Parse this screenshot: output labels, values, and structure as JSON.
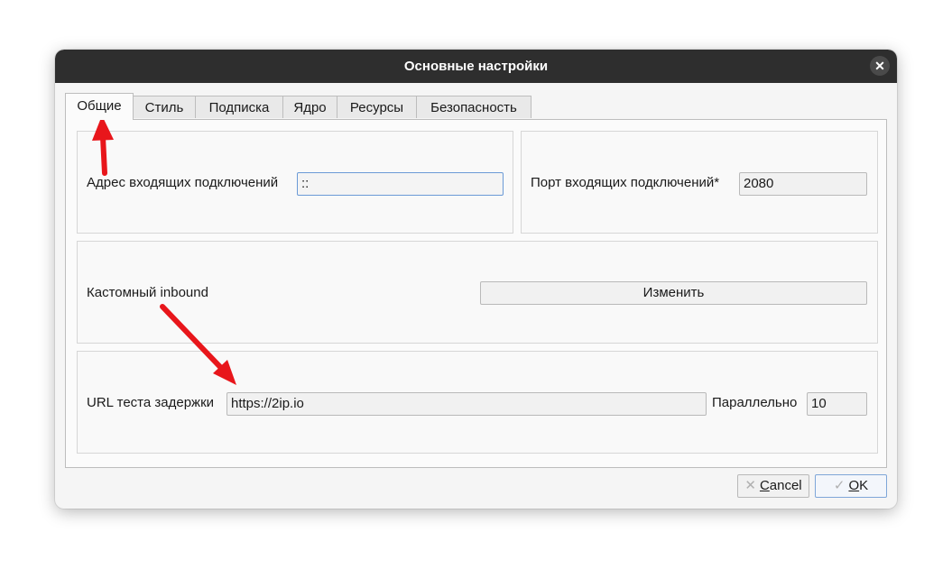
{
  "window": {
    "title": "Основные настройки",
    "close_icon": "close-icon"
  },
  "tabs": [
    {
      "label": "Общие",
      "active": true
    },
    {
      "label": "Стиль"
    },
    {
      "label": "Подписка"
    },
    {
      "label": "Ядро"
    },
    {
      "label": "Ресурсы"
    },
    {
      "label": "Безопасность"
    }
  ],
  "inbound": {
    "address_label": "Адрес входящих подключений",
    "address_value": "::",
    "port_label": "Порт входящих подключений*",
    "port_value": "2080"
  },
  "custom_inbound": {
    "label": "Кастомный inbound",
    "button_label": "Изменить"
  },
  "latency": {
    "url_label": "URL теста задержки",
    "url_value": "https://2ip.io",
    "parallel_label": "Параллельно",
    "parallel_value": "10"
  },
  "footer": {
    "cancel_prefix": "C",
    "cancel_rest": "ancel",
    "ok_prefix": "O",
    "ok_rest": "K"
  },
  "colors": {
    "annotation_arrow": "#e8161b",
    "titlebar": "#2e2e2e"
  }
}
